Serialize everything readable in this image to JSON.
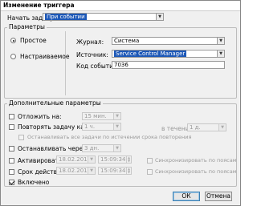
{
  "window": {
    "title": "Изменение триггера"
  },
  "task_start": {
    "label": "Начать задачу:",
    "value": "При событии"
  },
  "params": {
    "group_title": "Параметры",
    "radio_simple": "Простое",
    "radio_custom": "Настраиваемое",
    "journal_label": "Журнал:",
    "journal_value": "Система",
    "source_label": "Источник:",
    "source_value": "Service Control Manager",
    "event_code_label": "Код события:",
    "event_code_value": "7036"
  },
  "extra": {
    "group_title": "Дополнительные параметры",
    "delay_label": "Отложить на:",
    "delay_value": "15 мин.",
    "repeat_label": "Повторять задачу каждые:",
    "repeat_value": "1 ч.",
    "during_label": "в течение:",
    "during_value": "1 д.",
    "stop_all_label": "Останавливать все задачи по истечении срока повторения",
    "stop_after_label": "Останавливать через:",
    "stop_after_value": "3 дн.",
    "activate_label": "Активировать:",
    "activate_date": "18.02.2018",
    "activate_time": "15:09:34",
    "sync_zones_1": "Синхронизировать по поясам",
    "expire_label": "Срок действия:",
    "expire_date": "18.02.2019",
    "expire_time": "15:09:34",
    "sync_zones_2": "Синхронизировать по поясам",
    "enabled_label": "Включено"
  },
  "buttons": {
    "ok": "ОК",
    "cancel": "Отмена"
  }
}
